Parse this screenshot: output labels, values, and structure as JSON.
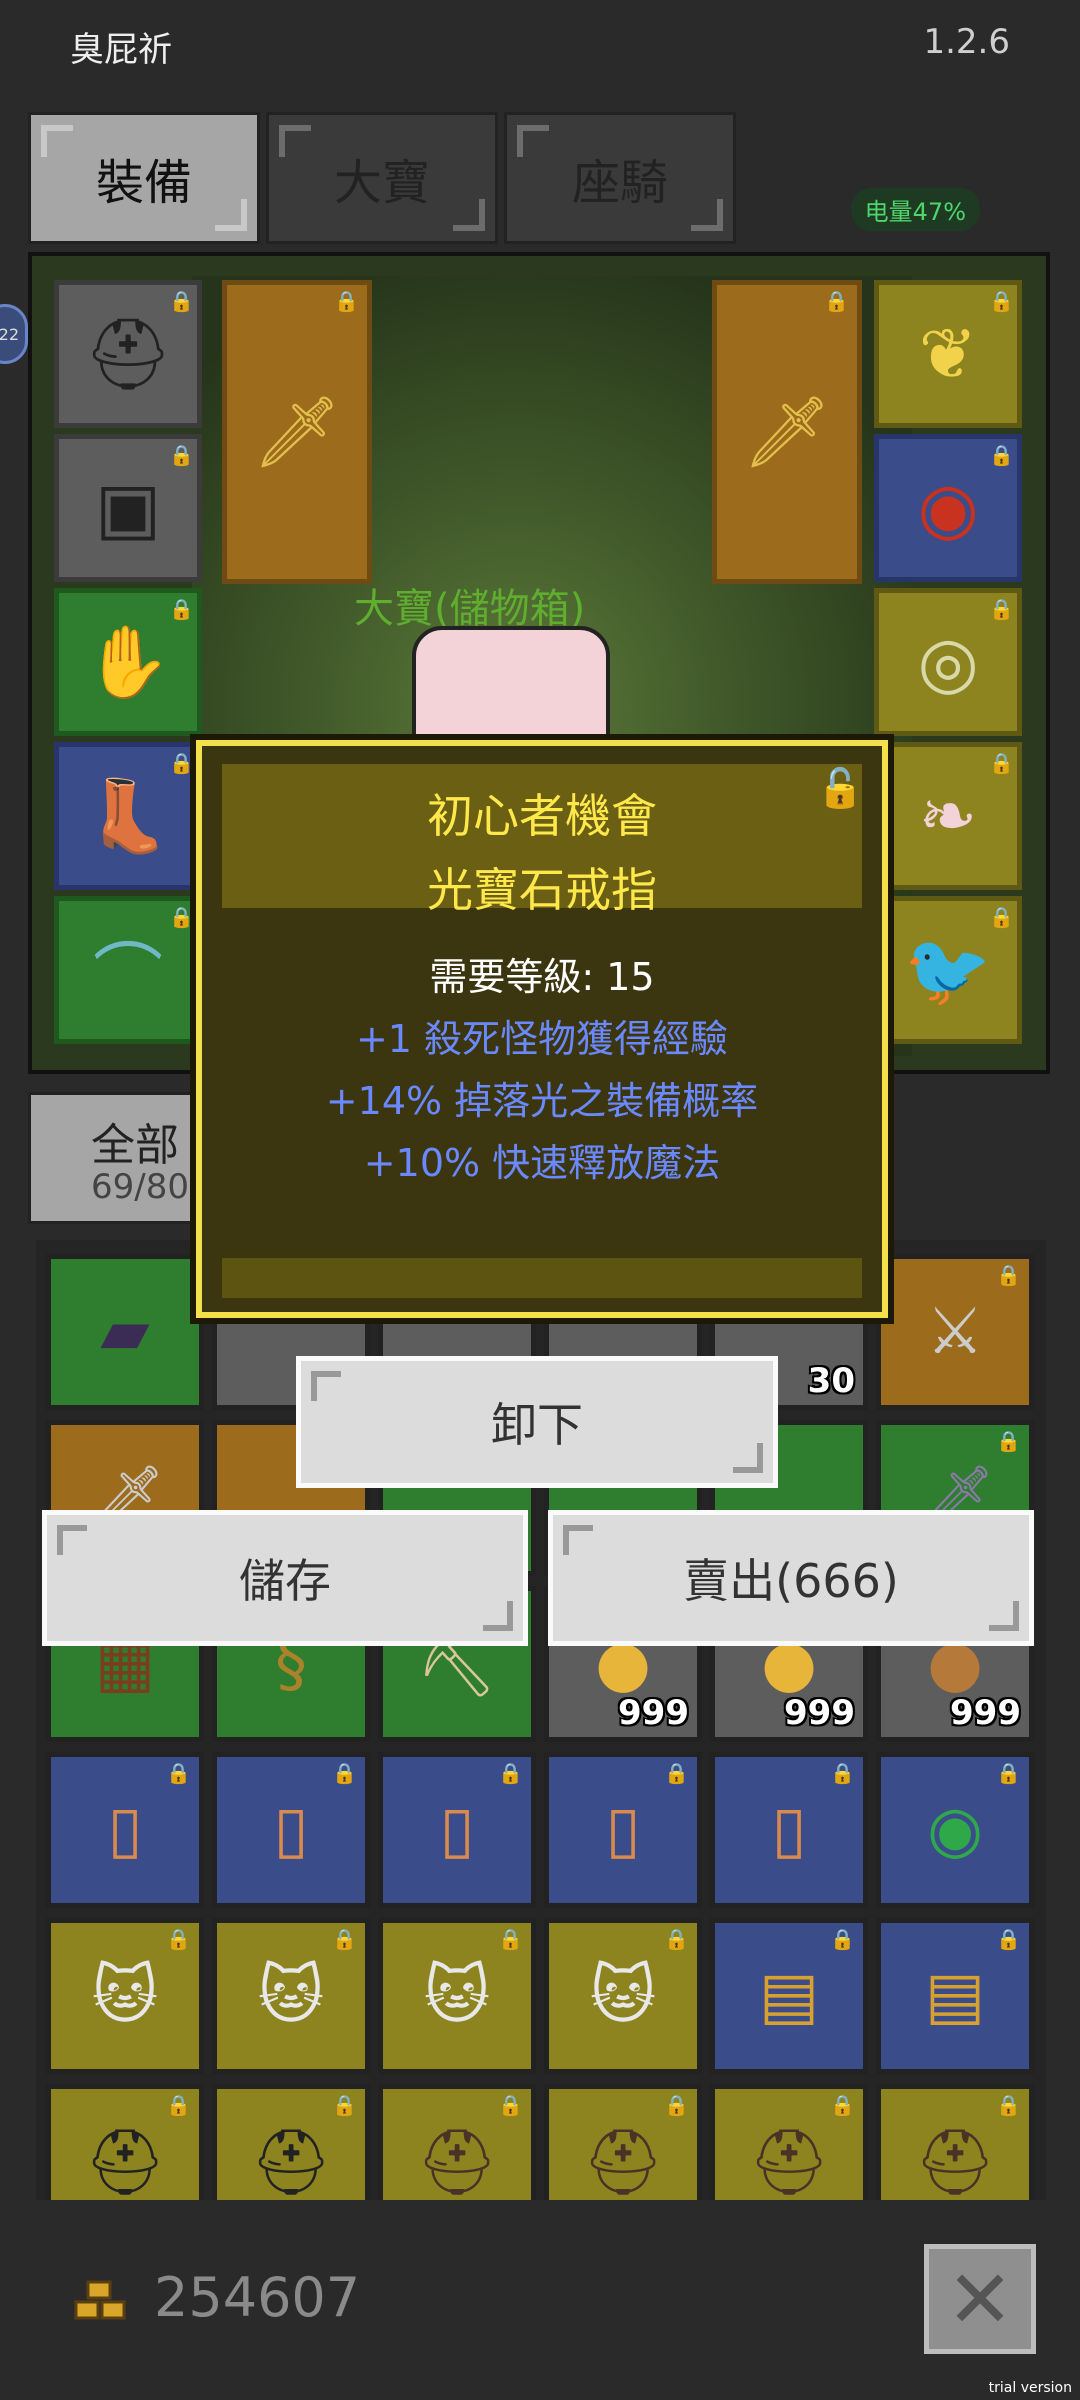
{
  "header": {
    "title": "臭屁祈",
    "version": "1.2.6"
  },
  "tabs": [
    {
      "label": "裝備",
      "active": true
    },
    {
      "label": "大寶",
      "active": false
    },
    {
      "label": "座騎",
      "active": false
    }
  ],
  "battery": "电量47%",
  "side_badge": "22",
  "equipment": {
    "chest_label": "大寶(儲物箱)"
  },
  "inventory_tab": {
    "label": "全部",
    "count": "69/80"
  },
  "inventory_counts": {
    "c30": "30",
    "c999a": "999",
    "c999b": "999",
    "c999c": "999"
  },
  "tooltip": {
    "name_line1": "初心者機會",
    "name_line2": "光寶石戒指",
    "requirement": "需要等級: 15",
    "stats": [
      "+1 殺死怪物獲得經驗",
      "+14% 掉落光之裝備概率",
      "+10% 快速釋放魔法"
    ]
  },
  "actions": {
    "unequip": "卸下",
    "store": "儲存",
    "sell": "賣出(666)"
  },
  "footer": {
    "gold": "254607"
  },
  "watermark": "trial version",
  "colors": {
    "tooltip_border": "#f4e04a",
    "tooltip_title": "#ffe84a",
    "stat_blue": "#6b89ff",
    "battery_green": "#4fd66a"
  },
  "icons": {
    "lock": "lock-icon",
    "close": "close-icon",
    "gold": "gold-coins-icon"
  }
}
